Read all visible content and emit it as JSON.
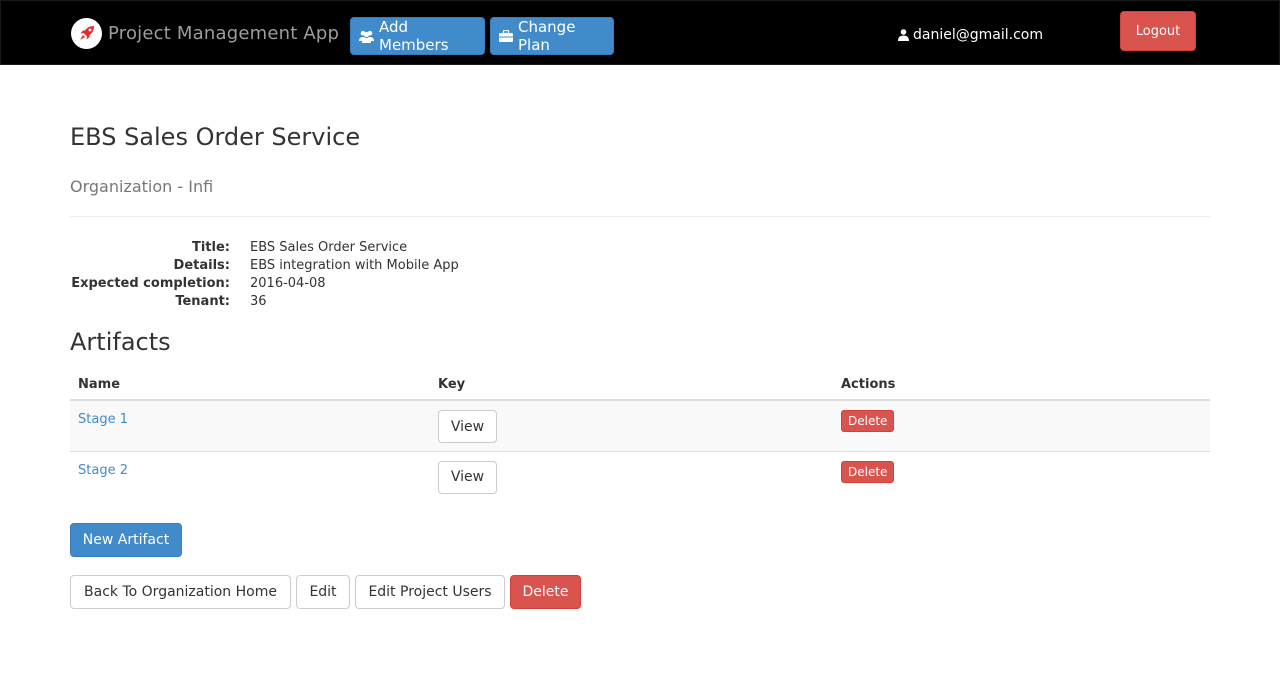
{
  "navbar": {
    "brand_name": "Project Management App",
    "brand_icon": "rocket-icon",
    "add_members_label": "Add Members",
    "add_members_icon": "users-icon",
    "change_plan_label": "Change Plan",
    "change_plan_icon": "briefcase-icon",
    "user_email": "daniel@gmail.com",
    "user_icon": "user-icon",
    "logout_label": "Logout"
  },
  "project": {
    "title": "EBS Sales Order Service",
    "subtitle": "Organization - Infi",
    "details": [
      {
        "label": "Title:",
        "value": "EBS Sales Order Service"
      },
      {
        "label": "Details:",
        "value": "EBS integration with Mobile App"
      },
      {
        "label": "Expected completion:",
        "value": "2016-04-08"
      },
      {
        "label": "Tenant:",
        "value": "36"
      }
    ]
  },
  "artifacts": {
    "heading": "Artifacts",
    "columns": [
      "Name",
      "Key",
      "Actions"
    ],
    "rows": [
      {
        "name": "Stage 1",
        "key_button": "View",
        "action_button": "Delete"
      },
      {
        "name": "Stage 2",
        "key_button": "View",
        "action_button": "Delete"
      }
    ],
    "new_button": "New Artifact"
  },
  "actions": {
    "back": "Back To Organization Home",
    "edit": "Edit",
    "edit_users": "Edit Project Users",
    "delete": "Delete"
  },
  "colors": {
    "navbar_bg": "#000000",
    "primary": "#428bca",
    "danger": "#d9534f",
    "rocket": "#e52d27"
  }
}
